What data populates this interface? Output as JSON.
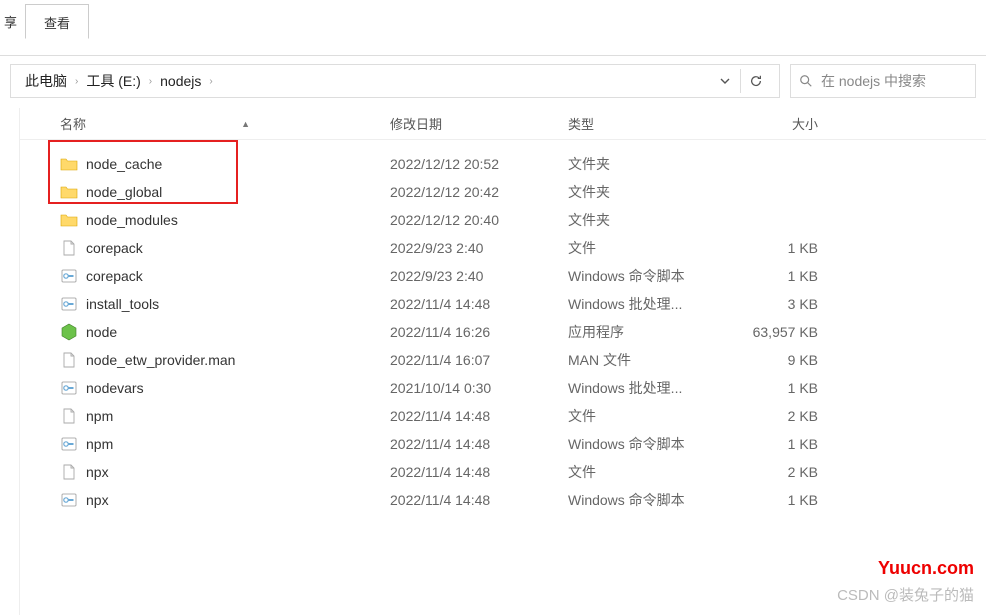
{
  "ribbon": {
    "share": "享",
    "view": "查看"
  },
  "breadcrumb": {
    "pc": "此电脑",
    "drive": "工具 (E:)",
    "folder": "nodejs"
  },
  "search": {
    "placeholder": "在 nodejs 中搜索"
  },
  "headers": {
    "name": "名称",
    "date": "修改日期",
    "type": "类型",
    "size": "大小"
  },
  "files": [
    {
      "icon": "folder",
      "name": "node_cache",
      "date": "2022/12/12 20:52",
      "type": "文件夹",
      "size": ""
    },
    {
      "icon": "folder",
      "name": "node_global",
      "date": "2022/12/12 20:42",
      "type": "文件夹",
      "size": ""
    },
    {
      "icon": "folder",
      "name": "node_modules",
      "date": "2022/12/12 20:40",
      "type": "文件夹",
      "size": ""
    },
    {
      "icon": "file",
      "name": "corepack",
      "date": "2022/9/23 2:40",
      "type": "文件",
      "size": "1 KB"
    },
    {
      "icon": "cmd",
      "name": "corepack",
      "date": "2022/9/23 2:40",
      "type": "Windows 命令脚本",
      "size": "1 KB"
    },
    {
      "icon": "bat",
      "name": "install_tools",
      "date": "2022/11/4 14:48",
      "type": "Windows 批处理...",
      "size": "3 KB"
    },
    {
      "icon": "node",
      "name": "node",
      "date": "2022/11/4 16:26",
      "type": "应用程序",
      "size": "63,957 KB"
    },
    {
      "icon": "file",
      "name": "node_etw_provider.man",
      "date": "2022/11/4 16:07",
      "type": "MAN 文件",
      "size": "9 KB"
    },
    {
      "icon": "bat",
      "name": "nodevars",
      "date": "2021/10/14 0:30",
      "type": "Windows 批处理...",
      "size": "1 KB"
    },
    {
      "icon": "file",
      "name": "npm",
      "date": "2022/11/4 14:48",
      "type": "文件",
      "size": "2 KB"
    },
    {
      "icon": "cmd",
      "name": "npm",
      "date": "2022/11/4 14:48",
      "type": "Windows 命令脚本",
      "size": "1 KB"
    },
    {
      "icon": "file",
      "name": "npx",
      "date": "2022/11/4 14:48",
      "type": "文件",
      "size": "2 KB"
    },
    {
      "icon": "cmd",
      "name": "npx",
      "date": "2022/11/4 14:48",
      "type": "Windows 命令脚本",
      "size": "1 KB"
    }
  ],
  "watermark": {
    "site": "Yuucn.com",
    "author": "CSDN @装兔子的猫"
  }
}
